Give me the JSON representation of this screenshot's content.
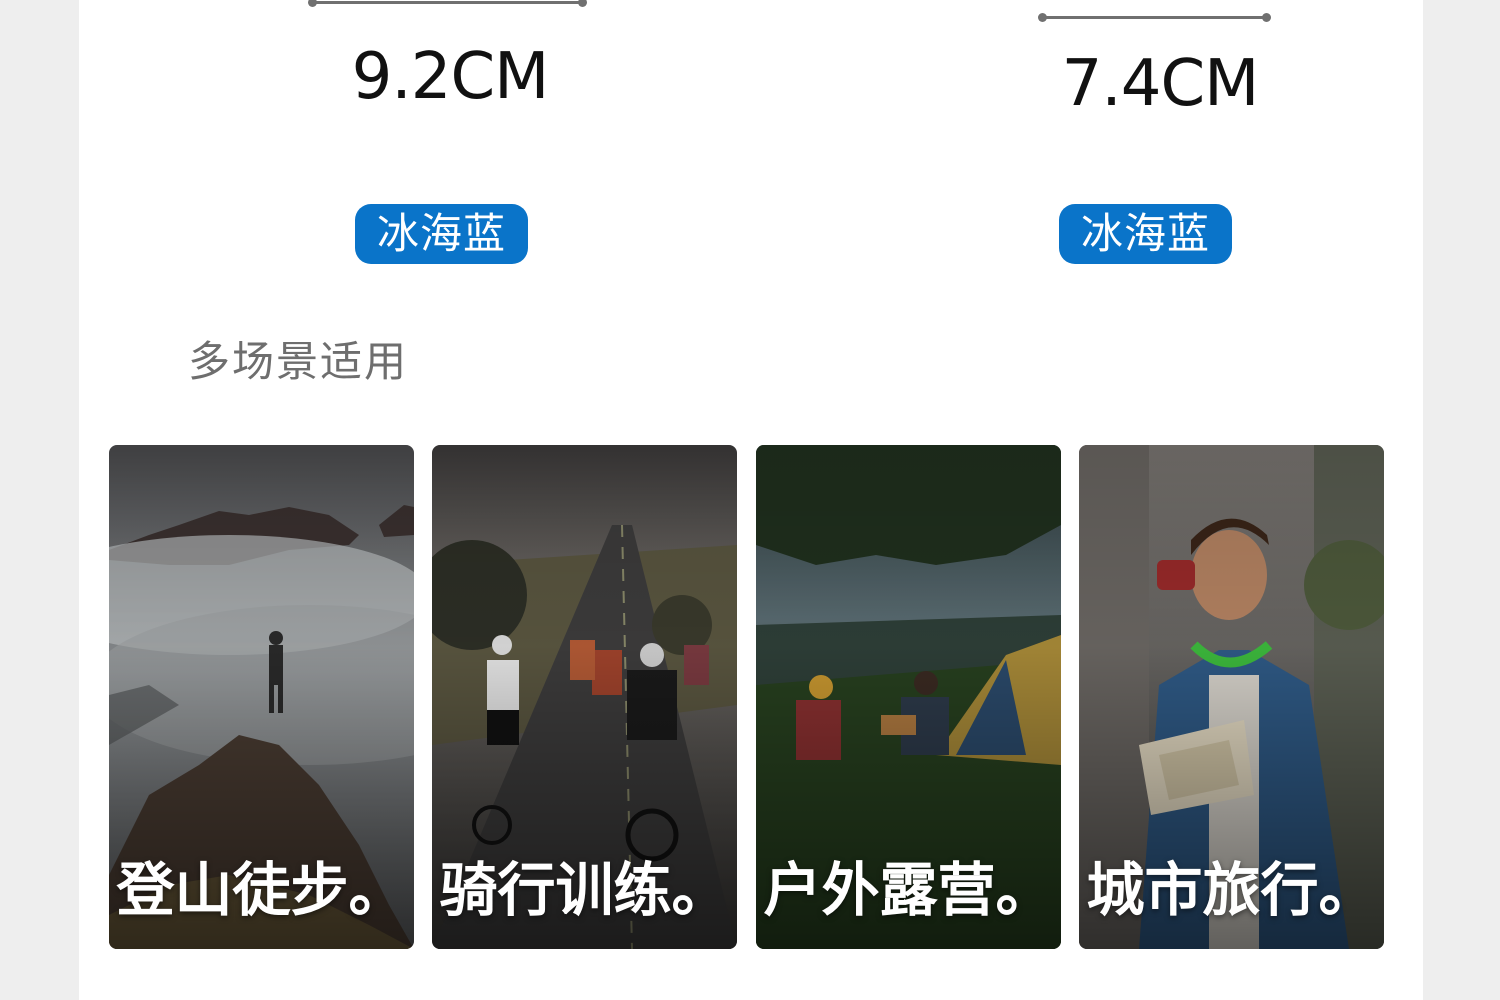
{
  "products": [
    {
      "measurement": "9.2CM",
      "color_badge": "冰海蓝"
    },
    {
      "measurement": "7.4CM",
      "color_badge": "冰海蓝"
    }
  ],
  "section_title": "多场景适用",
  "scenes": [
    {
      "caption": "登山徒步。",
      "icon": "mountain-hiker-photo"
    },
    {
      "caption": "骑行训练。",
      "icon": "cyclists-road-photo"
    },
    {
      "caption": "户外露营。",
      "icon": "camping-tent-photo"
    },
    {
      "caption": "城市旅行。",
      "icon": "city-traveler-photo"
    }
  ],
  "colors": {
    "badge": "#0a74c9",
    "measurement_text": "#111111",
    "section_title": "#6e6e6e",
    "background": "#ffffff",
    "page_margin": "#eeeeee"
  }
}
